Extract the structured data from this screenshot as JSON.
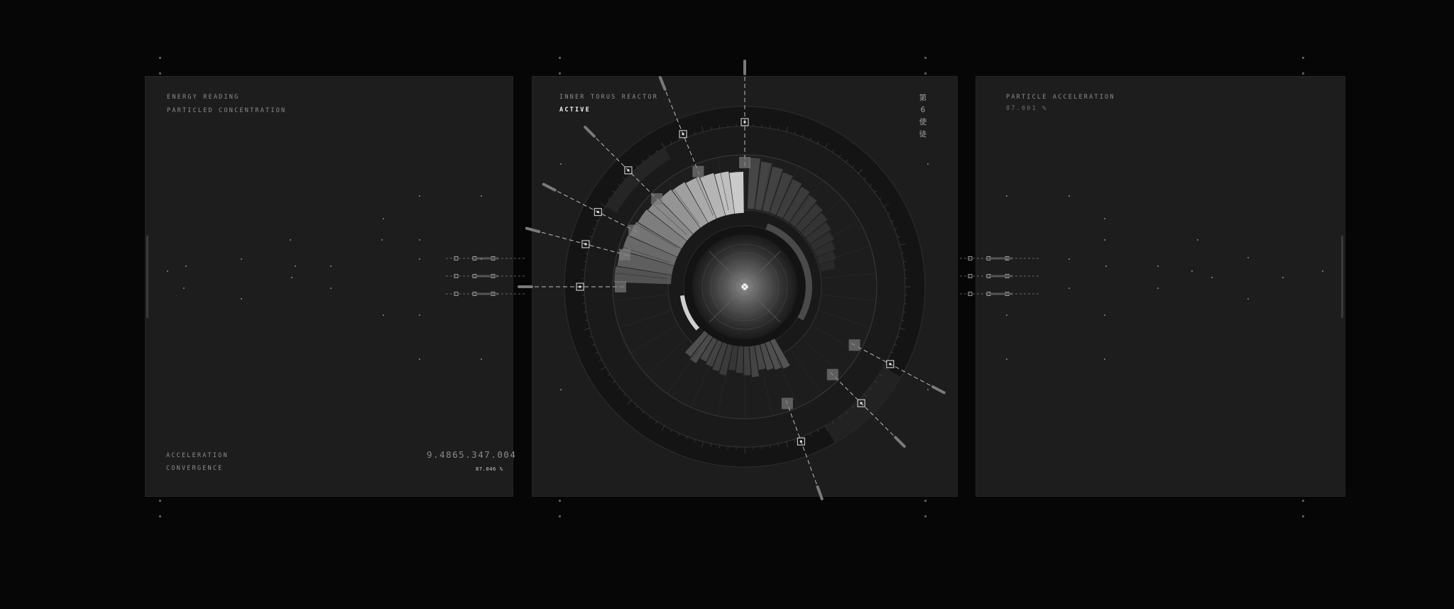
{
  "left_panel": {
    "energy_label": "ENERGY READING",
    "particle_label": "PARTICLED CONCENTRATION",
    "acceleration_label": "ACCELERATION",
    "convergence_label": "CONVERGENCE",
    "big_readout": "9.4865.347.004",
    "small_readout": "87.046 %"
  },
  "center_panel": {
    "title": "INNER TORUS REACTOR",
    "status": "ACTIVE",
    "kanji": [
      "第",
      "6",
      "使",
      "徒"
    ]
  },
  "right_panel": {
    "title": "PARTICLE ACCELERATION",
    "value": "87.001 %"
  },
  "colors": {
    "background": "#060606",
    "panel": "#1e1d1e",
    "accent_light": "#f0f0f0",
    "accent_gray": "#8a8a8a"
  },
  "icons": [
    "crosshair-icon",
    "bracket-marker-icon",
    "connector-arrow-icon"
  ]
}
